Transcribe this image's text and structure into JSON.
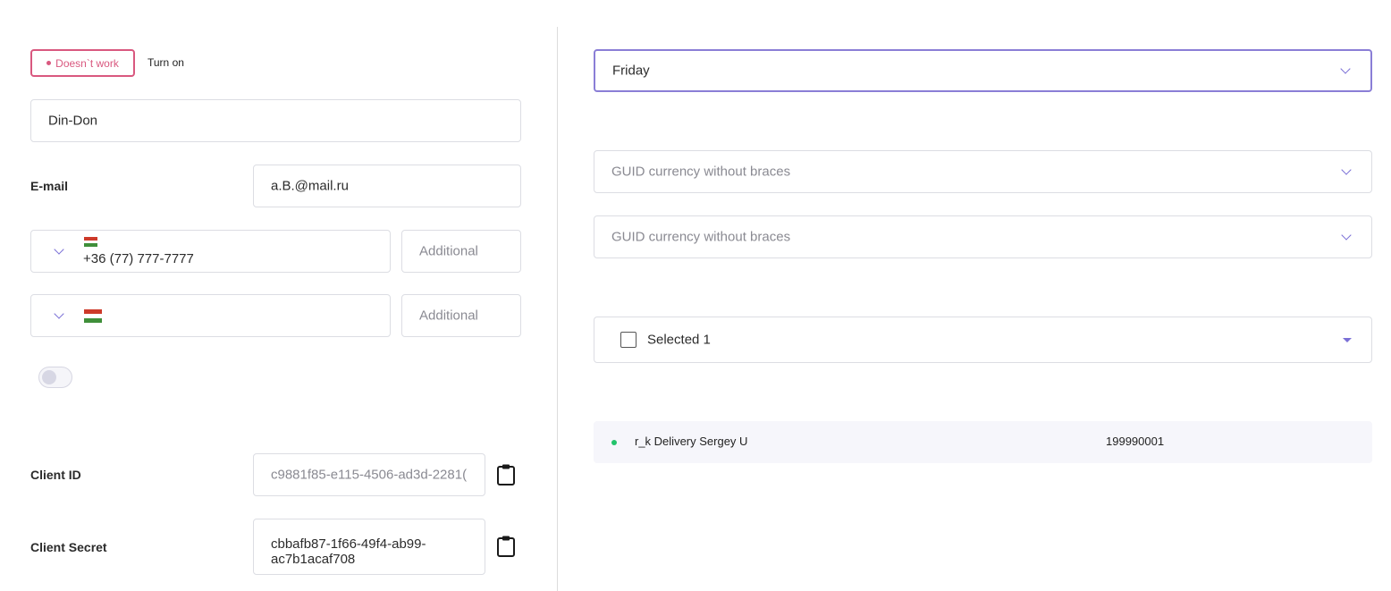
{
  "status": {
    "badge_label": "Doesn`t work",
    "action_label": "Turn on",
    "badge_color": "#d9587f"
  },
  "name_field": {
    "value": "Din-Don"
  },
  "email": {
    "label": "E-mail",
    "value": "a.B.@mail.ru"
  },
  "phones": [
    {
      "country_flag": "hungary-flag-icon",
      "value": "+36 (77) 777-7777",
      "additional_placeholder": "Additional"
    },
    {
      "country_flag": "hungary-flag-icon",
      "value": "",
      "additional_placeholder": "Additional"
    }
  ],
  "toggle": {
    "on": false
  },
  "client_id": {
    "label": "Client ID",
    "value": "c9881f85-e115-4506-ad3d-2281("
  },
  "client_secret": {
    "label": "Client Secret",
    "value_line1": "cbbafb87-1f66-49f4-ab99-",
    "value_line2": "ac7b1acaf708"
  },
  "day_select": {
    "value": "Friday"
  },
  "currency_selects": [
    {
      "placeholder": "GUID currency without braces"
    },
    {
      "placeholder": "GUID currency without braces"
    }
  ],
  "multi_select": {
    "label": "Selected 1"
  },
  "delivery": {
    "name": "r_k Delivery Sergey U",
    "code": "199990001",
    "status_color": "#22c36b"
  },
  "colors": {
    "accent": "#7a6fd6",
    "border": "#dcdde3"
  }
}
